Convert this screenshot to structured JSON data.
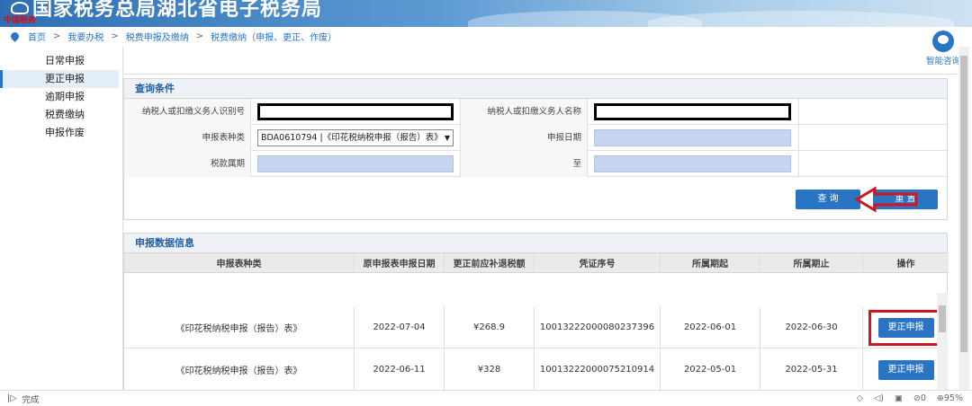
{
  "header": {
    "title": "国家税务总局湖北省电子税务局",
    "brand": "中国税务"
  },
  "breadcrumb": [
    "首页",
    "我要办税",
    "税费申报及缴纳",
    "税费缴纳（申报、更正、作废）"
  ],
  "sidebar": {
    "items": [
      {
        "label": "日常申报"
      },
      {
        "label": "更正申报",
        "active": true
      },
      {
        "label": "逾期申报"
      },
      {
        "label": "税费缴纳"
      },
      {
        "label": "申报作废"
      }
    ]
  },
  "help": {
    "label": "智能咨询"
  },
  "query": {
    "section_title": "查询条件",
    "taxpayer_id_label": "纳税人或扣缴义务人识别号",
    "taxpayer_name_label": "纳税人或扣缴义务人名称",
    "form_type_label": "申报表种类",
    "form_type_value": "BDA0610794 |《印花税纳税申报（报告）表》",
    "report_date_label": "申报日期",
    "tax_period_label": "税款属期",
    "to_label": "至",
    "search_button": "查 询",
    "reset_button": "重 置"
  },
  "results": {
    "section_title": "申报数据信息",
    "columns": [
      "申报表种类",
      "原申报表申报日期",
      "更正前应补退税额",
      "凭证序号",
      "所属期起",
      "所属期止",
      "操作"
    ],
    "rows": [
      {
        "form": "《印花税纳税申报（报告）表》",
        "date": "2022-07-04",
        "amount": "¥268.9",
        "voucher": "10013222000080237396",
        "start": "2022-06-01",
        "end": "2022-06-30",
        "action": "更正申报"
      },
      {
        "form": "《印花税纳税申报（报告）表》",
        "date": "2022-06-11",
        "amount": "¥328",
        "voucher": "10013222000075210914",
        "start": "2022-05-01",
        "end": "2022-05-31",
        "action": "更正申报"
      }
    ]
  },
  "status": {
    "text": "完成",
    "zoom": "95%",
    "count": "0"
  },
  "colors": {
    "accent": "#2a74c4",
    "highlight": "#d4141c"
  }
}
